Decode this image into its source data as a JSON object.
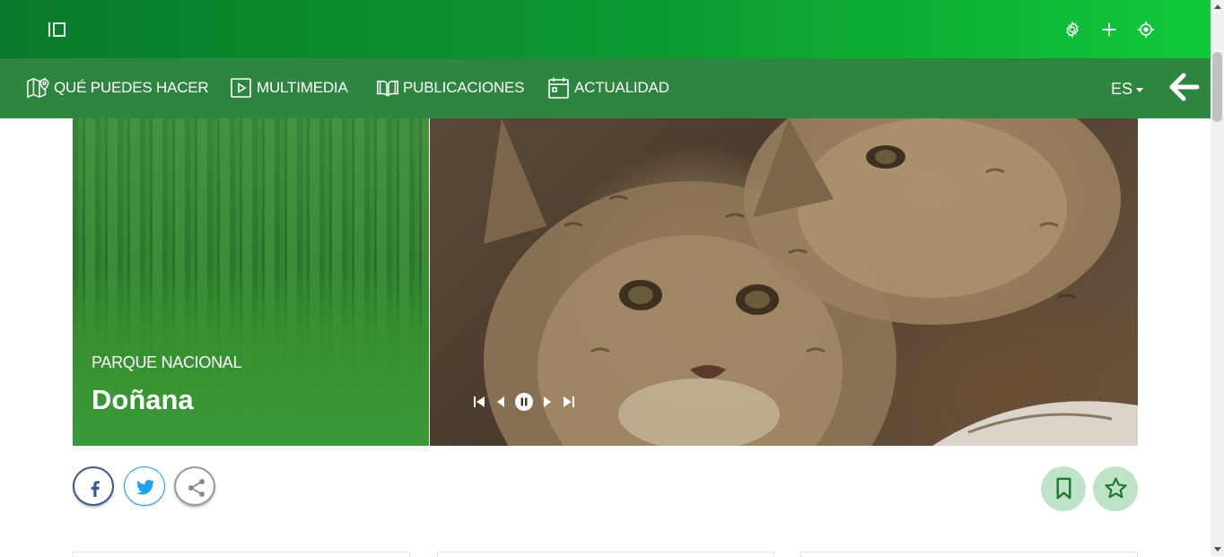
{
  "topbar": {
    "icons": [
      "sidebar-toggle-icon",
      "settings-icon",
      "plus-icon",
      "locate-icon"
    ]
  },
  "nav": {
    "items": [
      {
        "label": "QUÉ PUEDES HACER",
        "icon": "map-pin-icon"
      },
      {
        "label": "MULTIMEDIA",
        "icon": "play-icon"
      },
      {
        "label": "PUBLICACIONES",
        "icon": "book-icon"
      },
      {
        "label": "ACTUALIDAD",
        "icon": "calendar-icon"
      }
    ],
    "language": "ES",
    "back_icon": "arrow-left-icon"
  },
  "hero": {
    "subtitle": "PARQUE NACIONAL",
    "title": "Doñana",
    "controls": [
      "skip-back-icon",
      "prev-icon",
      "pause-icon",
      "next-icon",
      "skip-forward-icon"
    ]
  },
  "social": [
    "facebook-icon",
    "twitter-icon",
    "share-icon"
  ],
  "actions": [
    "bookmark-icon",
    "star-icon"
  ],
  "colors": {
    "topbar_start": "#0a7a2a",
    "topbar_end": "#10c93a",
    "navbar": "#2e8540",
    "action_bg": "#bfe3c9",
    "action_icon": "#1f7a35",
    "facebook": "#3b5998",
    "twitter": "#1da1f2"
  }
}
